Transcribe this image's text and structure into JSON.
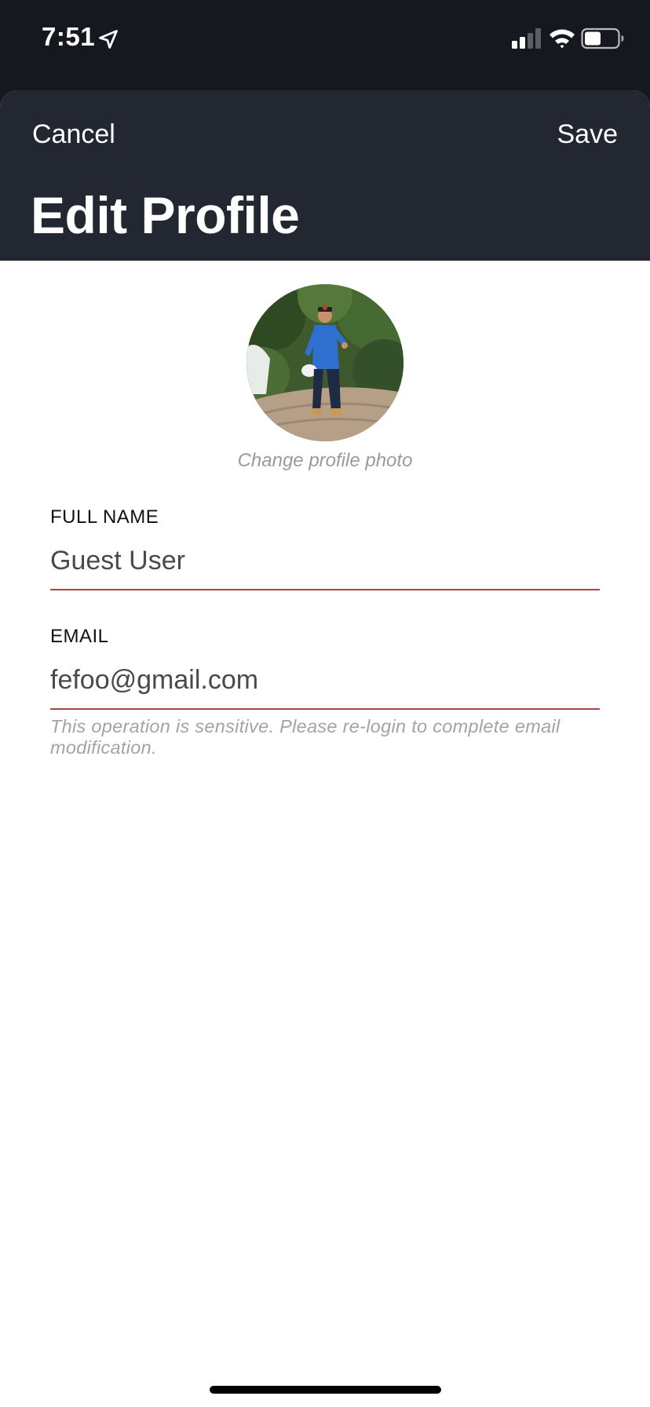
{
  "status_bar": {
    "time": "7:51"
  },
  "header": {
    "cancel_label": "Cancel",
    "save_label": "Save",
    "title": "Edit Profile"
  },
  "profile": {
    "change_photo_label": "Change profile photo"
  },
  "form": {
    "full_name": {
      "label": "FULL NAME",
      "value": "Guest User"
    },
    "email": {
      "label": "EMAIL",
      "value": "fefoo@gmail.com",
      "hint": "This operation is sensitive. Please re-login to complete email modification."
    }
  },
  "colors": {
    "header_background": "#222732",
    "status_bar_background": "#15191f",
    "field_underline": "#b8413d",
    "hint_text": "#a3a3a3"
  },
  "icons": {
    "status_location": "location-arrow-icon",
    "status_signal": "cellular-signal-icon",
    "status_wifi": "wifi-icon",
    "status_battery": "battery-icon"
  }
}
